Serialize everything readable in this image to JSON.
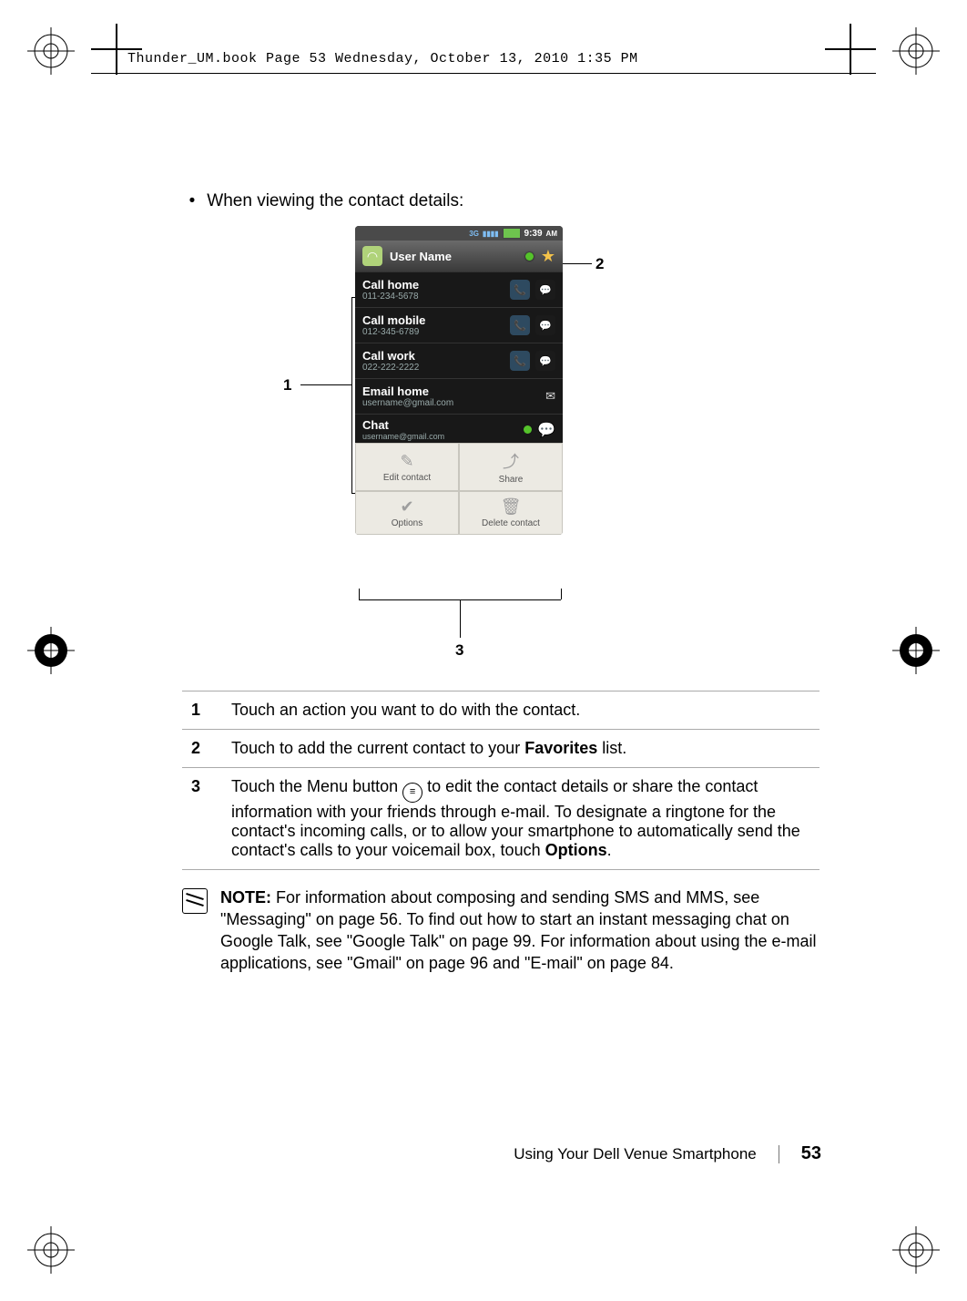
{
  "source_line": "Thunder_UM.book  Page 53  Wednesday, October 13, 2010  1:35 PM",
  "bullet_text": "When viewing the contact details:",
  "callout_label_1": "1",
  "callout_label_2": "2",
  "callout_label_3": "3",
  "phone": {
    "status": {
      "signal_3g": "3G",
      "time": "9:39",
      "ampm": "AM"
    },
    "header": {
      "user_name": "User Name"
    },
    "rows": {
      "call_home": {
        "title": "Call home",
        "sub": "011-234-5678"
      },
      "call_mobile": {
        "title": "Call mobile",
        "sub": "012-345-6789"
      },
      "call_work": {
        "title": "Call work",
        "sub": "022-222-2222"
      },
      "email_home": {
        "title": "Email home",
        "sub": "username@gmail.com"
      },
      "chat": {
        "title": "Chat",
        "sub": "username@gmail.com"
      }
    },
    "menu": {
      "edit": "Edit contact",
      "share": "Share",
      "options": "Options",
      "delete": "Delete contact"
    }
  },
  "table": {
    "r1": "Touch an action you want to do with the contact.",
    "r2_pre": "Touch to add the current contact to your ",
    "r2_bold": "Favorites",
    "r2_post": " list.",
    "r3_pre": "Touch the Menu button ",
    "r3_mid": " to edit the contact details or share the contact information with your friends through e-mail. To designate a ringtone for the contact's incoming calls, or to allow your smartphone to automatically send the contact's calls to your voicemail box, touch ",
    "r3_bold": "Options",
    "r3_post": "."
  },
  "note": {
    "label": "NOTE:",
    "body": " For information about composing and sending SMS and MMS, see \"Messaging\" on page 56. To find out how to start an instant messaging chat on Google Talk, see \"Google Talk\" on page 99. For information about using the e-mail applications, see \"Gmail\" on page 96 and \"E-mail\" on page 84."
  },
  "footer": {
    "section": "Using Your Dell Venue Smartphone",
    "page": "53"
  }
}
